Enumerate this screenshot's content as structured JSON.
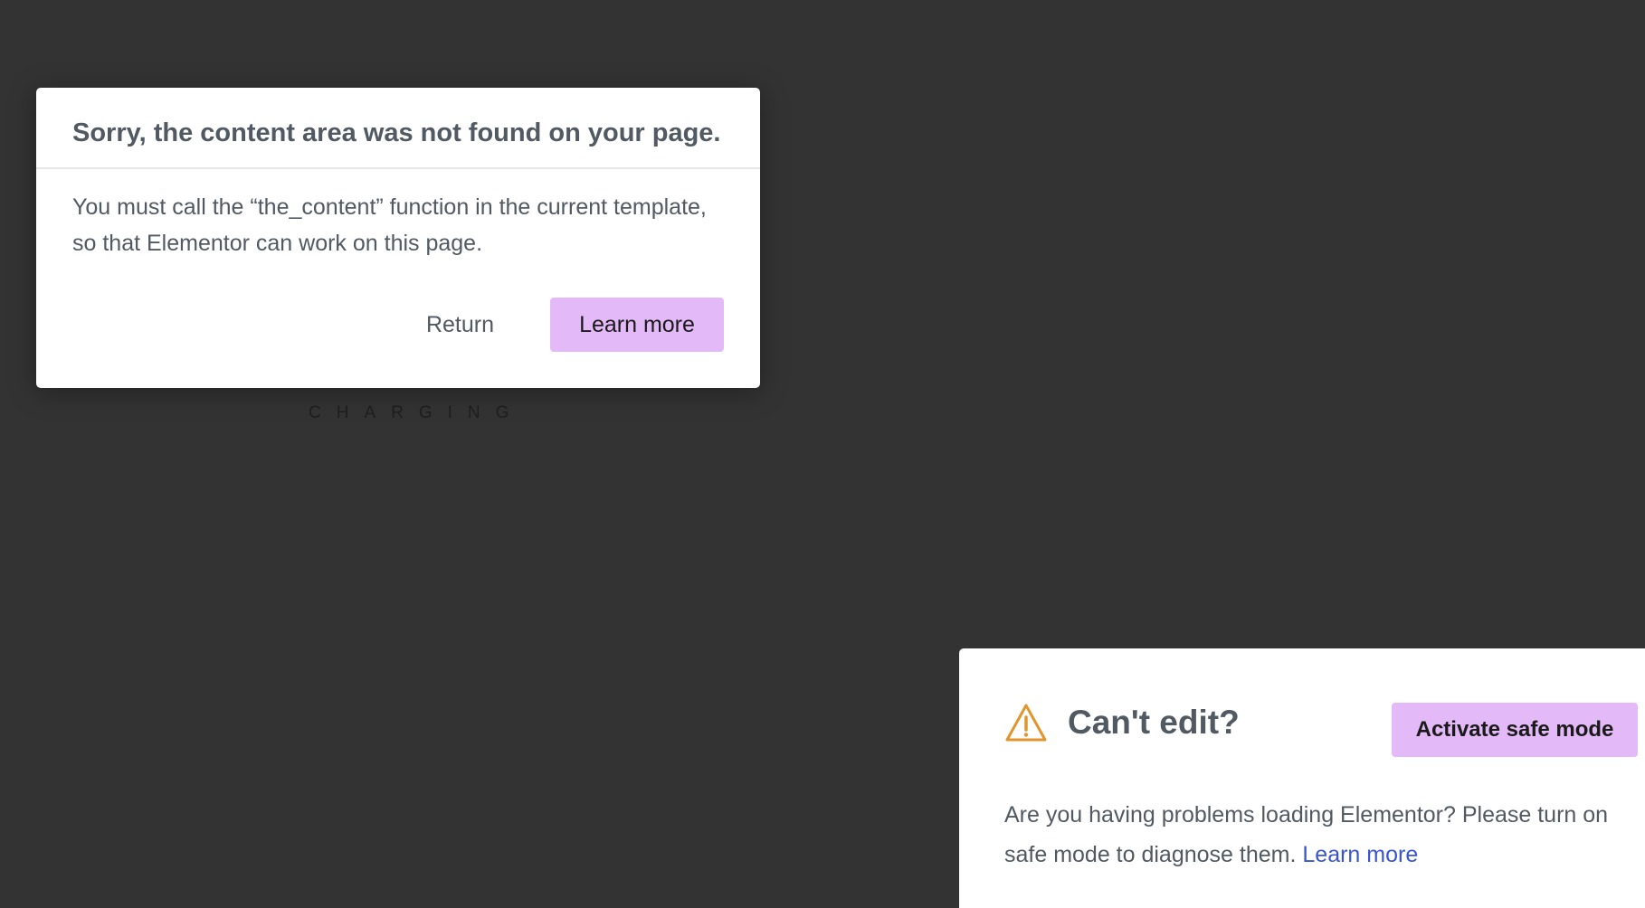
{
  "loader": {
    "text": "CHARGING"
  },
  "error_dialog": {
    "title": "Sorry, the content area was not found on your page.",
    "message": "You must call the “the_content” function in the current template, so that Elementor can work on this page.",
    "return_label": "Return",
    "learn_more_label": "Learn more",
    "accent_color": "#e3b9f8"
  },
  "safe_mode": {
    "icon": "warning-icon",
    "icon_color": "#e0952e",
    "title": "Can't edit?",
    "button_label": "Activate safe mode",
    "message": "Are you having problems loading Elementor? Please turn on safe mode to diagnose them.",
    "link_label": "Learn more",
    "link_color": "#3a54d6"
  }
}
